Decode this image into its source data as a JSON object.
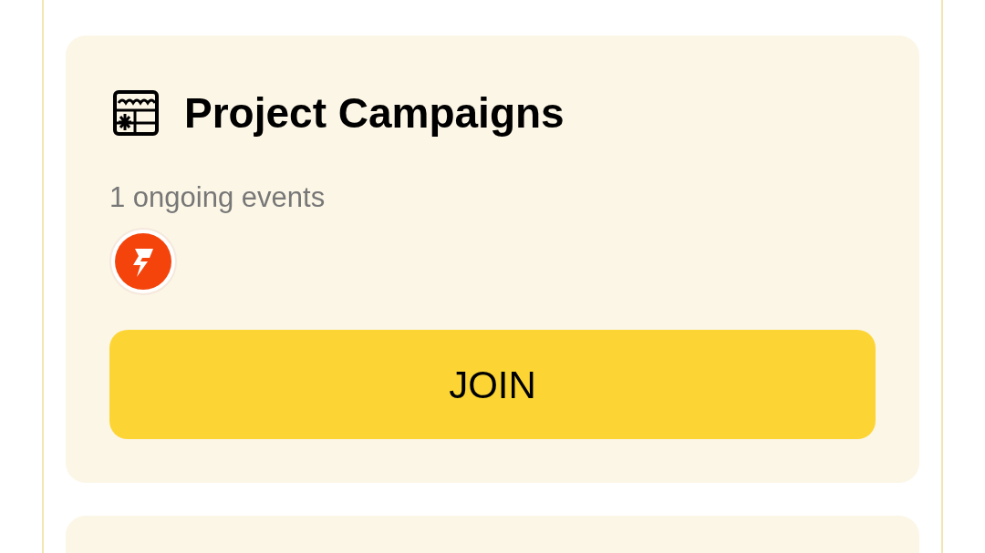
{
  "cards": [
    {
      "title": "Project Campaigns",
      "subtitle": "1 ongoing events",
      "participants": [
        {
          "kind": "bolt",
          "color": "#f4440c"
        }
      ],
      "button": "JOIN"
    }
  ]
}
